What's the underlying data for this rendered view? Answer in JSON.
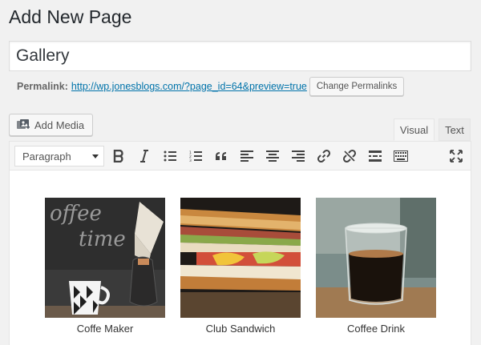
{
  "page": {
    "title": "Add New Page"
  },
  "post_title": {
    "value": "Gallery"
  },
  "permalink": {
    "label": "Permalink:",
    "url": "http://wp.jonesblogs.com/?page_id=64&preview=true",
    "button_label": "Change Permalinks"
  },
  "media": {
    "add_media_label": "Add Media"
  },
  "tabs": {
    "visual": "Visual",
    "text": "Text"
  },
  "toolbar": {
    "format_selected": "Paragraph",
    "buttons": [
      "bold-icon",
      "italic-icon",
      "bulleted-list-icon",
      "numbered-list-icon",
      "blockquote-icon",
      "align-left-icon",
      "align-center-icon",
      "align-right-icon",
      "insert-link-icon",
      "remove-link-icon",
      "read-more-icon",
      "toolbar-toggle-icon",
      "fullscreen-icon"
    ]
  },
  "gallery": [
    {
      "caption": "Coffe Maker",
      "image": "coffee-maker-photo"
    },
    {
      "caption": "Club Sandwich",
      "image": "club-sandwich-photo"
    },
    {
      "caption": "Coffee Drink",
      "image": "coffee-drink-photo"
    }
  ],
  "colors": {
    "link": "#0073aa",
    "background": "#f1f1f1",
    "text": "#23282d"
  }
}
